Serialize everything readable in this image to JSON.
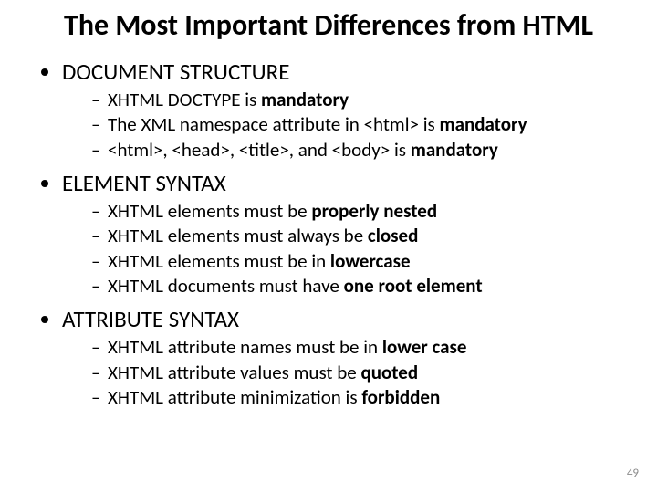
{
  "title": "The Most Important Differences from HTML",
  "page_number": "49",
  "sections": [
    {
      "heading": "DOCUMENT STRUCTURE",
      "items": [
        {
          "pre": "XHTML DOCTYPE is ",
          "bold": "mandatory",
          "post": ""
        },
        {
          "pre": "The XML namespace attribute in <html> is ",
          "bold": "mandatory",
          "post": ""
        },
        {
          "pre": "<html>, <head>, <title>, and <body> is ",
          "bold": "mandatory",
          "post": ""
        }
      ]
    },
    {
      "heading": "ELEMENT SYNTAX",
      "items": [
        {
          "pre": "XHTML elements must be ",
          "bold": "properly nested",
          "post": ""
        },
        {
          "pre": "XHTML elements must always be ",
          "bold": "closed",
          "post": ""
        },
        {
          "pre": "XHTML elements must be in ",
          "bold": "lowercase",
          "post": ""
        },
        {
          "pre": "XHTML documents must have ",
          "bold": "one root element",
          "post": ""
        }
      ]
    },
    {
      "heading": "ATTRIBUTE SYNTAX",
      "items": [
        {
          "pre": "XHTML attribute names must be in ",
          "bold": "lower case",
          "post": ""
        },
        {
          "pre": "XHTML attribute values must be ",
          "bold": "quoted",
          "post": ""
        },
        {
          "pre": "XHTML attribute minimization is ",
          "bold": "forbidden",
          "post": ""
        }
      ]
    }
  ]
}
